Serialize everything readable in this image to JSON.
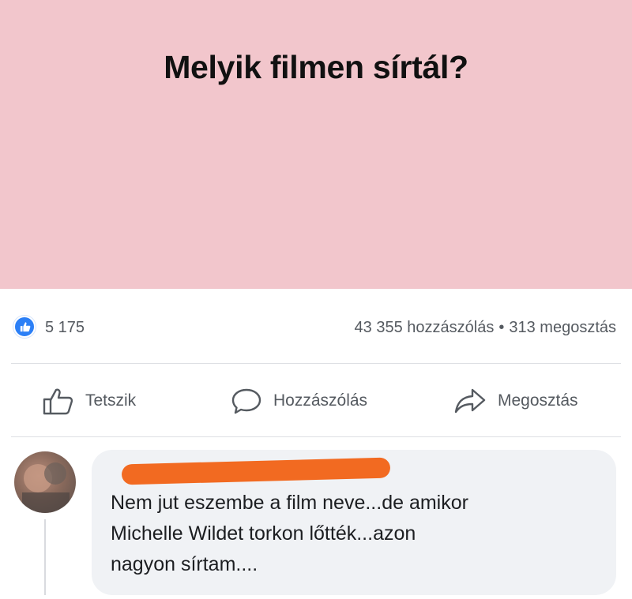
{
  "post": {
    "image_title": "Melyik filmen sírtál?",
    "background_color": "#f2c6cc"
  },
  "stats": {
    "like_count": "5 175",
    "comments": "43 355 hozzászólás",
    "separator": "•",
    "shares": "313 megosztás",
    "reaction_icon": "like-icon",
    "accent_color": "#2b7ff6"
  },
  "actions": {
    "like_label": "Tetszik",
    "comment_label": "Hozzászólás",
    "share_label": "Megosztás"
  },
  "comment": {
    "author": "",
    "text_line1": "Nem jut eszembe a film neve...de amikor",
    "text_line2": "Michelle Wildet torkon lőtték...azon",
    "text_line3": "nagyon sírtam....",
    "redaction_color": "#f26a21"
  }
}
